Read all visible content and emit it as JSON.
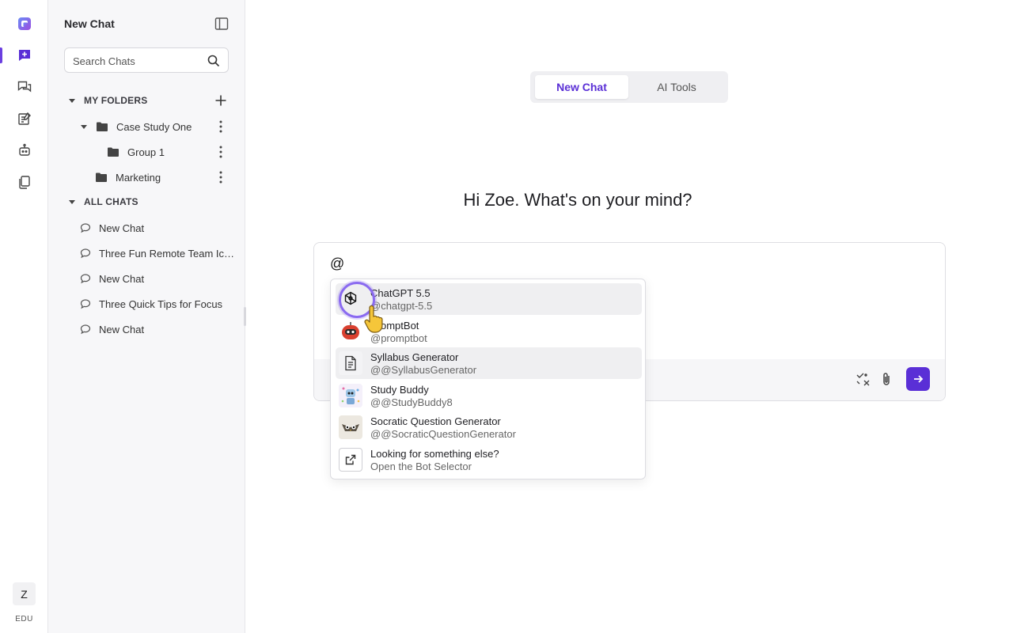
{
  "colors": {
    "accent": "#5a2fd6",
    "rail_active": "#6b3fe0"
  },
  "rail": {
    "icons": [
      "app-logo-icon",
      "new-chat-icon",
      "chats-icon",
      "notes-icon",
      "bot-icon",
      "files-icon"
    ],
    "avatar": "Z",
    "edu": "EDU"
  },
  "sidebar": {
    "title": "New Chat",
    "search_placeholder": "Search Chats",
    "my_folders": "MY FOLDERS",
    "folders": [
      {
        "name": "Case Study One"
      },
      {
        "name": "Group 1"
      },
      {
        "name": "Marketing"
      }
    ],
    "all_chats": "ALL CHATS",
    "chats": [
      "New Chat",
      "Three Fun Remote Team Icebreakers",
      "New Chat",
      "Three Quick Tips for Focus",
      "New Chat"
    ]
  },
  "main": {
    "tabs": [
      "New Chat",
      "AI Tools"
    ],
    "greeting": "Hi Zoe. What's on your mind?",
    "composer_value": "@"
  },
  "mentions": [
    {
      "name": "ChatGPT 5.5",
      "handle": "@chatgpt-5.5"
    },
    {
      "name": "PromptBot",
      "handle": "@promptbot"
    },
    {
      "name": "Syllabus Generator",
      "handle": "@@SyllabusGenerator"
    },
    {
      "name": "Study Buddy",
      "handle": "@@StudyBuddy8"
    },
    {
      "name": "Socratic Question Generator",
      "handle": "@@SocraticQuestionGenerator"
    },
    {
      "name": "Looking for something else?",
      "handle": "Open the Bot Selector"
    }
  ]
}
